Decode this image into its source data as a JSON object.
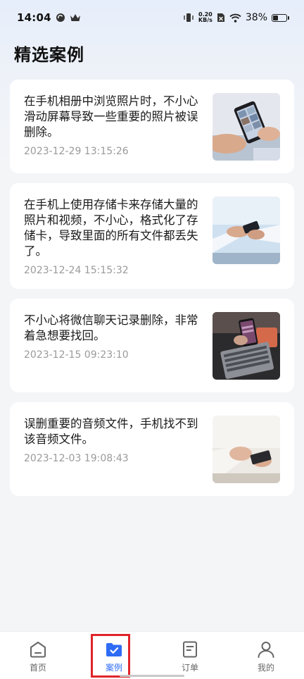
{
  "status_bar": {
    "time": "14:04",
    "net_speed_value": "0.20",
    "net_speed_unit": "KB/s",
    "battery_percent": "38%",
    "battery_level": 0.38
  },
  "page": {
    "title": "精选案例"
  },
  "cases": [
    {
      "title": "在手机相册中浏览照片时，不小心滑动屏幕导致一些重要的照片被误删除。",
      "date": "2023-12-29 13:15:26",
      "thumb": "phone-gallery-photo"
    },
    {
      "title": "在手机上使用存储卡来存储大量的照片和视频，不小心，格式化了存储卡，导致里面的所有文件都丢失了。",
      "date": "2023-12-24 15:15:32",
      "thumb": "handshake-phone-photo"
    },
    {
      "title": "不小心将微信聊天记录删除，非常着急想要找回。",
      "date": "2023-12-15 09:23:10",
      "thumb": "laptop-phone-photo"
    },
    {
      "title": "误删重要的音频文件，手机找不到该音频文件。",
      "date": "2023-12-03 19:08:43",
      "thumb": "hands-phone-photo"
    }
  ],
  "tabs": [
    {
      "label": "首页",
      "icon": "home-icon"
    },
    {
      "label": "案例",
      "icon": "folder-check-icon"
    },
    {
      "label": "订单",
      "icon": "order-doc-icon"
    },
    {
      "label": "我的",
      "icon": "user-icon"
    }
  ],
  "colors": {
    "accent": "#2f6cf5",
    "highlight_box": "#e0242a"
  }
}
